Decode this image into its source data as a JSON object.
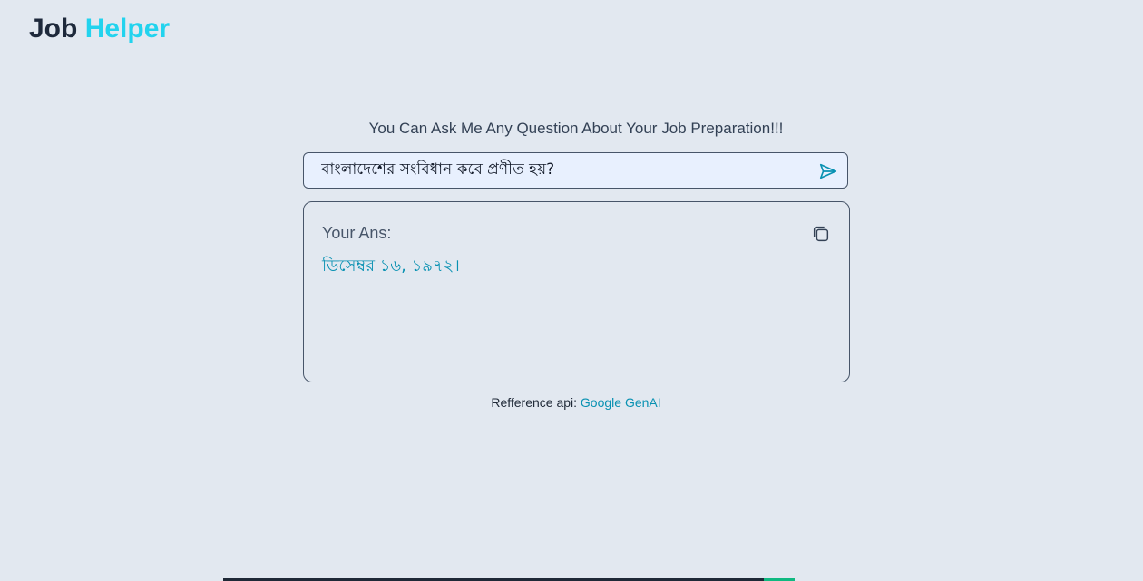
{
  "header": {
    "logo_word1": "Job",
    "logo_word2": "Helper"
  },
  "main": {
    "tagline": "You Can Ask Me Any Question About Your Job Preparation!!!",
    "search": {
      "value": "বাংলাদেশের সংবিধান কবে প্রণীত হয়?",
      "send_icon": "send-icon"
    },
    "answer": {
      "label": "Your Ans:",
      "text": "ডিসেম্বর ১৬, ১৯৭২।",
      "copy_icon": "copy-icon"
    }
  },
  "footer": {
    "prefix": "Refference api:",
    "link_text": "Google GenAI"
  },
  "colors": {
    "background": "#e2e8f0",
    "accent": "#22d3ee",
    "link": "#0891b2",
    "logo_dark": "#1e293b"
  }
}
